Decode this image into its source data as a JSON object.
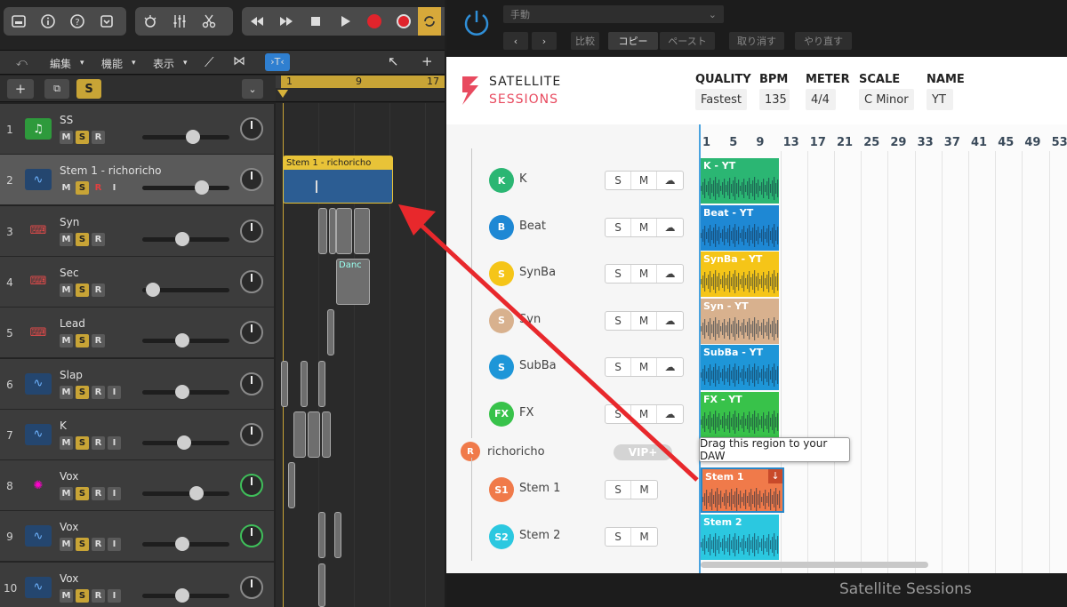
{
  "daw": {
    "menubar": {
      "edit": "編集",
      "function": "機能",
      "view": "表示"
    },
    "header": {
      "add": "+",
      "solo": "S"
    },
    "ruler": {
      "bar1": "1",
      "bar9": "9",
      "bar17": "17"
    },
    "tracks": [
      {
        "num": "1",
        "name": "SS",
        "icon": "music-note-icon",
        "btns": [
          "M",
          "S",
          "R"
        ],
        "vol": 0.6,
        "selected": false
      },
      {
        "num": "2",
        "name": "Stem 1 - richoricho",
        "icon": "waveform-icon",
        "btns": [
          "M",
          "S",
          "R",
          "I"
        ],
        "vol": 0.72,
        "selected": true
      },
      {
        "num": "3",
        "name": "Syn",
        "icon": "keyboard-icon",
        "btns": [
          "M",
          "S",
          "R"
        ],
        "vol": 0.45,
        "selected": false
      },
      {
        "num": "4",
        "name": "Sec",
        "icon": "keyboard-icon",
        "btns": [
          "M",
          "S",
          "R"
        ],
        "vol": 0.05,
        "selected": false
      },
      {
        "num": "5",
        "name": "Lead",
        "icon": "keyboard-icon",
        "btns": [
          "M",
          "S",
          "R"
        ],
        "vol": 0.45,
        "selected": false
      },
      {
        "num": "6",
        "name": "Slap",
        "icon": "waveform-icon",
        "btns": [
          "M",
          "S",
          "R",
          "I"
        ],
        "vol": 0.45,
        "selected": false
      },
      {
        "num": "7",
        "name": "K",
        "icon": "waveform-icon",
        "btns": [
          "M",
          "S",
          "R",
          "I"
        ],
        "vol": 0.48,
        "selected": false
      },
      {
        "num": "8",
        "name": "Vox",
        "icon": "sparkle-icon",
        "btns": [
          "M",
          "S",
          "R",
          "I"
        ],
        "vol": 0.65,
        "selected": false
      },
      {
        "num": "9",
        "name": "Vox",
        "icon": "waveform-icon",
        "btns": [
          "M",
          "S",
          "R",
          "I"
        ],
        "vol": 0.45,
        "selected": false
      },
      {
        "num": "10",
        "name": "Vox",
        "icon": "waveform-icon",
        "btns": [
          "M",
          "S",
          "R",
          "I"
        ],
        "vol": 0.45,
        "selected": false
      }
    ],
    "region": {
      "label": "Stem 1 - richoricho"
    },
    "mini_label": "Danc"
  },
  "plugin": {
    "mode": "手動",
    "compare": "比較",
    "copy": "コピー",
    "paste": "ペースト",
    "undo": "取り消す",
    "redo": "やり直す",
    "logo_line1": "SATELLITE",
    "logo_line2": "SESSIONS",
    "fields": [
      {
        "label": "QUALITY",
        "value": "Fastest"
      },
      {
        "label": "BPM",
        "value": "135"
      },
      {
        "label": "METER",
        "value": "4/4"
      },
      {
        "label": "SCALE",
        "value": "C Minor"
      },
      {
        "label": "NAME",
        "value": "YT"
      }
    ],
    "bars": [
      "1",
      "5",
      "9",
      "13",
      "17",
      "21",
      "25",
      "29",
      "33",
      "37",
      "41",
      "45",
      "49",
      "53"
    ],
    "stems": [
      {
        "badge": "K",
        "name": "K",
        "color": "#2bb673",
        "region": "K - YT"
      },
      {
        "badge": "B",
        "name": "Beat",
        "color": "#1e88d4",
        "region": "Beat - YT"
      },
      {
        "badge": "S",
        "name": "SynBa",
        "color": "#f5c518",
        "region": "SynBa - YT"
      },
      {
        "badge": "S",
        "name": "Syn",
        "color": "#d8b18e",
        "region": "Syn - YT"
      },
      {
        "badge": "S",
        "name": "SubBa",
        "color": "#1e96d8",
        "region": "SubBa - YT"
      },
      {
        "badge": "FX",
        "name": "FX",
        "color": "#38c24a",
        "region": "FX - YT"
      }
    ],
    "user": {
      "badge": "R",
      "name": "richoricho",
      "vip": "VIP+"
    },
    "user_stems": [
      {
        "badge": "S1",
        "name": "Stem 1",
        "color": "#f07a4a",
        "region": "Stem 1"
      },
      {
        "badge": "S2",
        "name": "Stem 2",
        "color": "#2bc8e0",
        "region": "Stem 2"
      }
    ],
    "btn_s": "S",
    "btn_m": "M",
    "tooltip": "Drag this region to your DAW",
    "footer": "Satellite Sessions"
  }
}
